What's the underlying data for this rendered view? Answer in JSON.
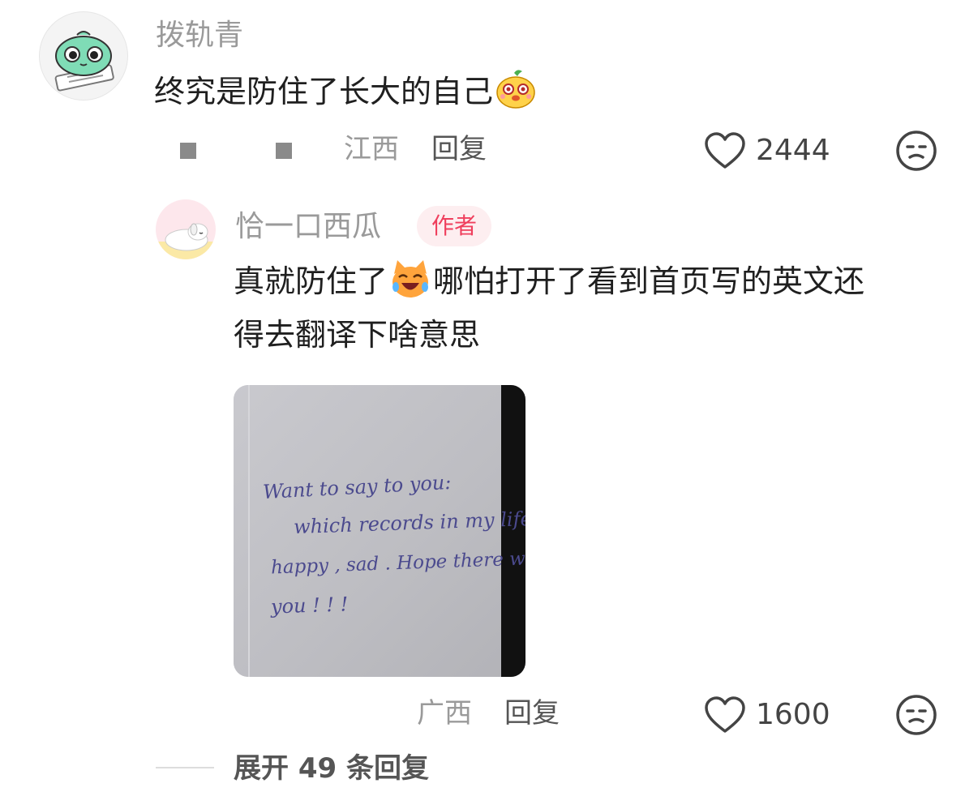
{
  "comment": {
    "username": "拨轨青",
    "text": "终究是防住了长大的自己",
    "emoji_icon": "chick-face-emoji-icon",
    "location": "江西",
    "reply_label": "回复",
    "like_count": "2444"
  },
  "reply": {
    "username": "恰一口西瓜",
    "badge": "作者",
    "text_before_emoji": "真就防住了",
    "emoji_icon": "laughing-cat-emoji-icon",
    "text_after_emoji": "哪怕打开了看到首页写的英文还",
    "text_line2": "得去翻译下啥意思",
    "photo": {
      "line1": "Want  to  say  to  you:",
      "line2": "which  records  in  my  life",
      "line3": "happy ,  sad .  Hope  there  will  be",
      "line4": "you ! ! !"
    },
    "location": "广西",
    "reply_label": "回复",
    "like_count": "1600"
  },
  "expand_replies": "展开 49 条回复",
  "colors": {
    "badge_text": "#ef3f5d",
    "badge_bg": "#fdeef0",
    "username": "#9a9a9a",
    "ink": "#4b4a8e"
  }
}
